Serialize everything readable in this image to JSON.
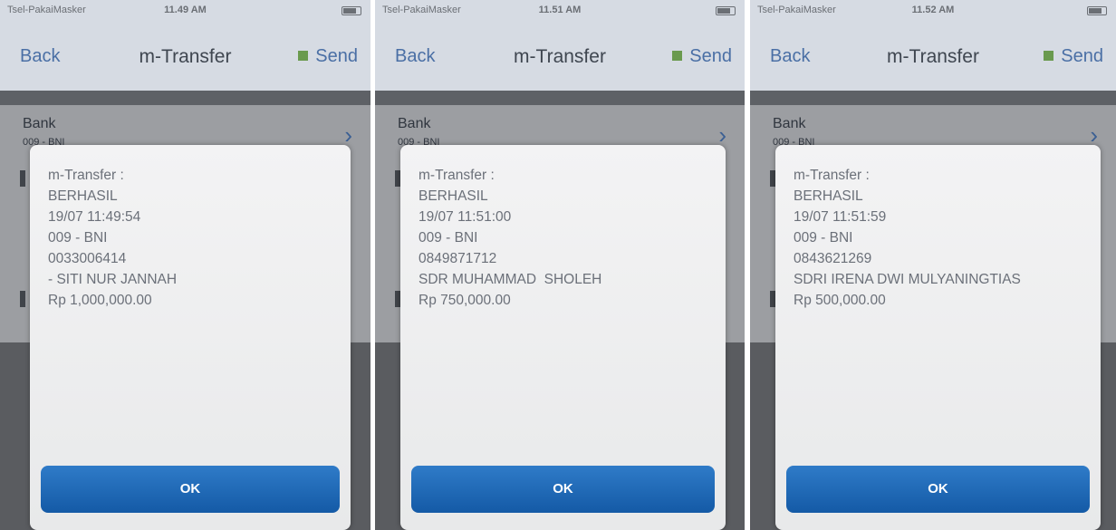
{
  "screens": [
    {
      "status": {
        "carrier": "Tsel-PakaiMasker",
        "time": "11.49 AM"
      },
      "nav": {
        "back": "Back",
        "title": "m-Transfer",
        "send": "Send"
      },
      "form": {
        "bank_label": "Bank",
        "bank_value": "009 - BNI"
      },
      "dialog": {
        "lines": [
          "m-Transfer :",
          "BERHASIL",
          "19/07 11:49:54",
          "009 - BNI",
          "0033006414",
          "- SITI NUR JANNAH",
          "Rp 1,000,000.00"
        ],
        "ok": "OK"
      }
    },
    {
      "status": {
        "carrier": "Tsel-PakaiMasker",
        "time": "11.51 AM"
      },
      "nav": {
        "back": "Back",
        "title": "m-Transfer",
        "send": "Send"
      },
      "form": {
        "bank_label": "Bank",
        "bank_value": "009 - BNI"
      },
      "dialog": {
        "lines": [
          "m-Transfer :",
          "BERHASIL",
          "19/07 11:51:00",
          "009 - BNI",
          "0849871712",
          "SDR MUHAMMAD  SHOLEH",
          "Rp 750,000.00"
        ],
        "ok": "OK"
      }
    },
    {
      "status": {
        "carrier": "Tsel-PakaiMasker",
        "time": "11.52 AM"
      },
      "nav": {
        "back": "Back",
        "title": "m-Transfer",
        "send": "Send"
      },
      "form": {
        "bank_label": "Bank",
        "bank_value": "009 - BNI"
      },
      "dialog": {
        "lines": [
          "m-Transfer :",
          "BERHASIL",
          "19/07 11:51:59",
          "009 - BNI",
          "0843621269",
          "SDRI IRENA DWI MULYANINGTIAS",
          "Rp 500,000.00"
        ],
        "ok": "OK"
      }
    }
  ]
}
